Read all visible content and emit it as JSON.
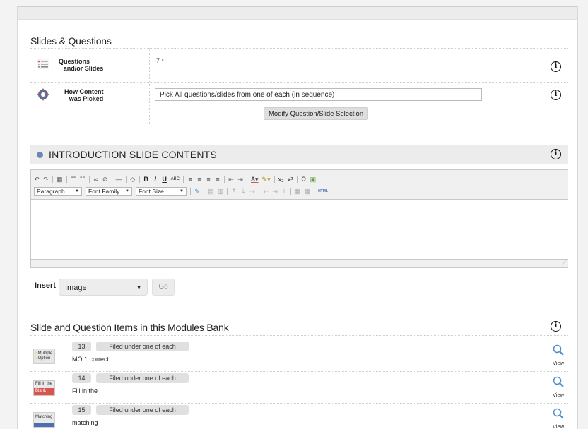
{
  "slides_section": {
    "title": "Slides & Questions",
    "rows": [
      {
        "label_line1": "Questions",
        "label_line2": "and/or Slides",
        "value": "7 *"
      },
      {
        "label_line1": "How Content",
        "label_line2": "was Picked",
        "value": "Pick All questions/slides from one of each (in sequence)",
        "button": "Modify Question/Slide Selection"
      }
    ],
    "info_glyph": "i"
  },
  "intro": {
    "title": "INTRODUCTION SLIDE CONTENTS",
    "toolbar": {
      "format_select": "Paragraph",
      "font_family_select": "Font Family",
      "font_size_select": "Font Size",
      "html_label": "HTML"
    }
  },
  "insert": {
    "label": "Insert",
    "selected": "Image",
    "go_label": "Go"
  },
  "bank": {
    "title": "Slide and Question Items in this Modules Bank",
    "view_label": "View",
    "items": [
      {
        "number": "13",
        "filed": "Filed under one of each",
        "name": "MO 1 correct",
        "thumb_text1": "Multiple",
        "thumb_text2": "Option"
      },
      {
        "number": "14",
        "filed": "Filed under one of each",
        "name": "Fill in the",
        "thumb_text1": "Fill in the",
        "thumb_text2": "Blank"
      },
      {
        "number": "15",
        "filed": "Filed under one of each",
        "name": "matching",
        "thumb_text1": "Matching",
        "thumb_text2": ""
      }
    ]
  },
  "colors": {
    "accent_blue": "#4d8fd1",
    "bar_grey": "#ececec",
    "badge_grey": "#e0e0e0"
  },
  "icons": [
    "list-icon",
    "gear-arrows-icon",
    "info-icon",
    "bullet-icon",
    "magnifier-icon"
  ]
}
